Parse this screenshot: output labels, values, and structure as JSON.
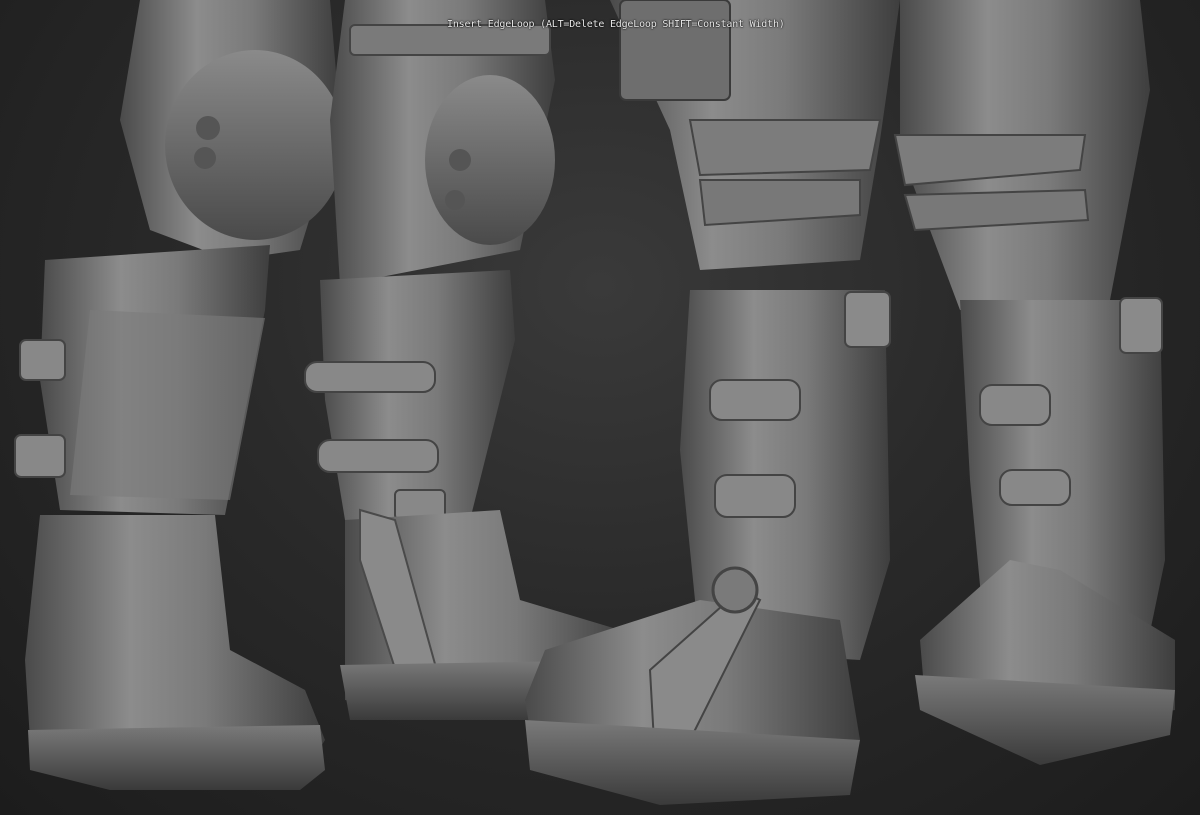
{
  "viewport": {
    "tooltip": "Insert EdgeLoop (ALT=Delete EdgeLoop SHIFT=Constant Width)"
  },
  "colors": {
    "background": "#262626",
    "matcap_light": "#9a9a9a",
    "matcap_mid": "#6e6e6e",
    "matcap_dark": "#3c3c3c"
  },
  "icons": {
    "model": "sculpt-mesh"
  }
}
